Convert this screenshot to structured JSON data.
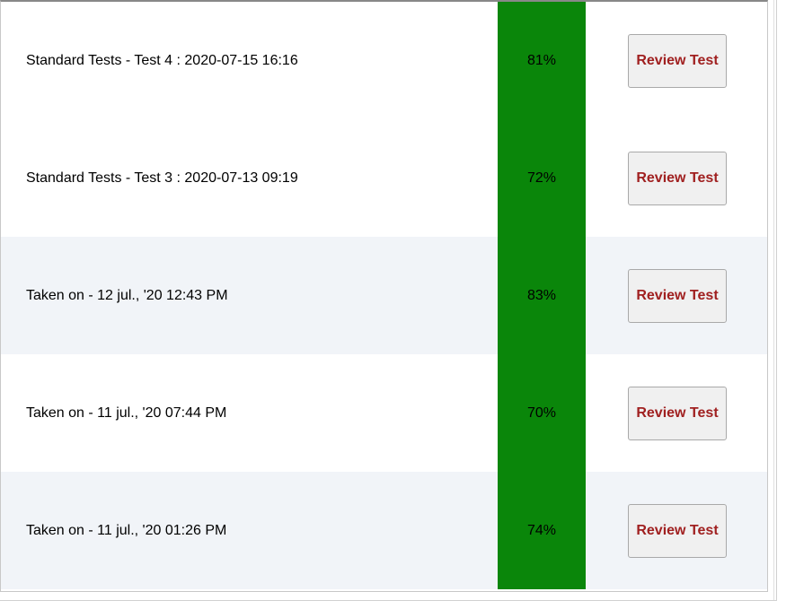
{
  "buttonLabel": "Review Test",
  "rows": [
    {
      "label": "Standard Tests - Test 4 : 2020-07-15 16:16",
      "score": "81%",
      "alt": false
    },
    {
      "label": "Standard Tests - Test 3 : 2020-07-13 09:19",
      "score": "72%",
      "alt": false
    },
    {
      "label": "Taken on - 12 jul., '20 12:43 PM",
      "score": "83%",
      "alt": true
    },
    {
      "label": "Taken on - 11 jul., '20 07:44 PM",
      "score": "70%",
      "alt": false
    },
    {
      "label": "Taken on - 11 jul., '20 01:26 PM",
      "score": "74%",
      "alt": true
    }
  ]
}
